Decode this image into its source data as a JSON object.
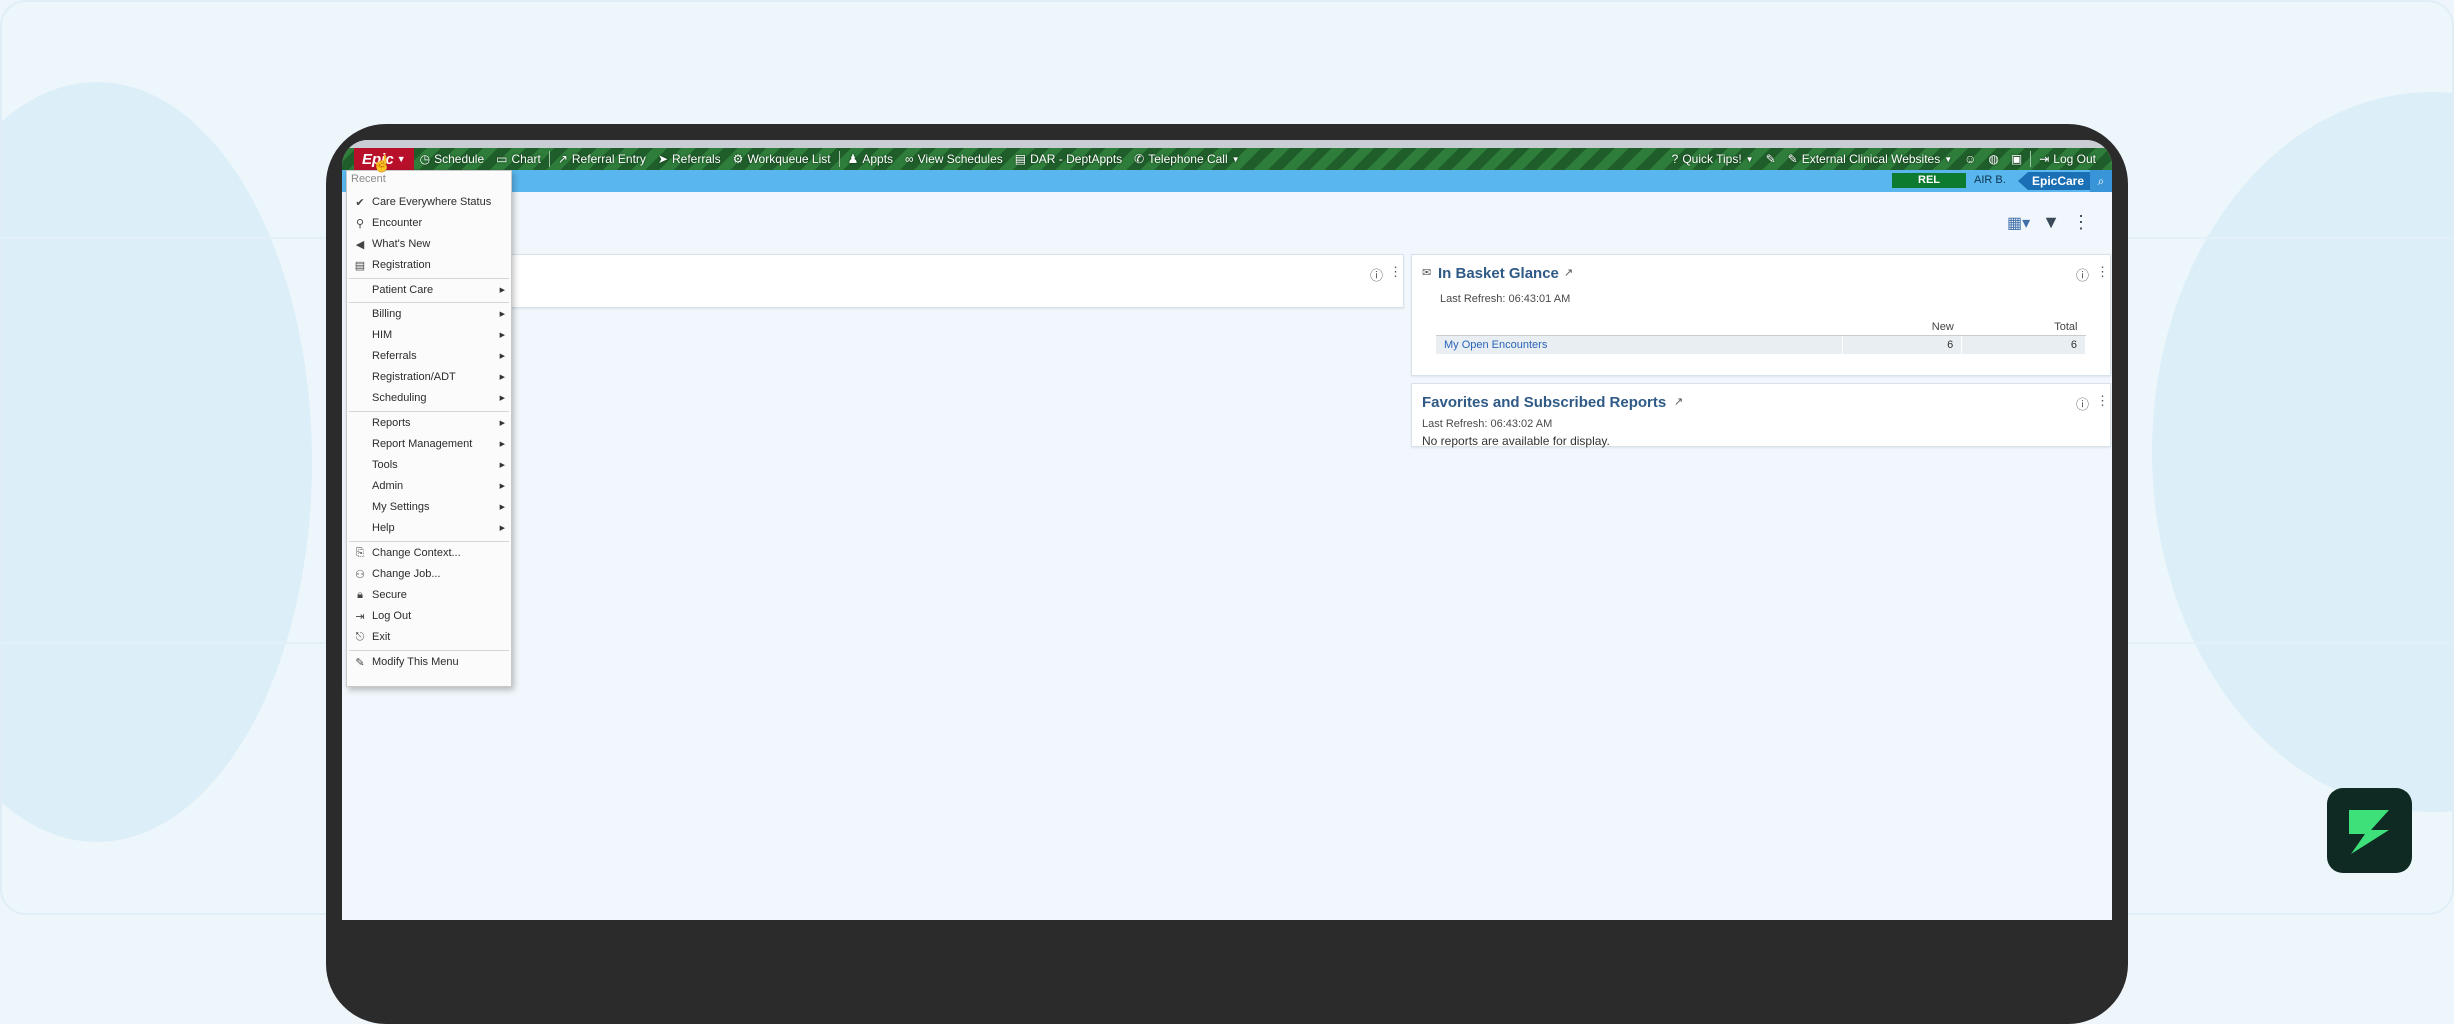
{
  "colors": {
    "accent_green": "#2e7d3a",
    "epic_red": "#b8102a",
    "header_blue": "#5ab6ee",
    "link_blue": "#2a63b8",
    "title_blue": "#2f5a86"
  },
  "toolbar": {
    "epic_label": "Epic",
    "items": [
      {
        "label": "Schedule",
        "icon": "clock-icon"
      },
      {
        "label": "Chart",
        "icon": "folder-icon"
      },
      {
        "label": "Referral Entry",
        "icon": "referral-icon"
      },
      {
        "label": "Referrals",
        "icon": "arrow-icon"
      },
      {
        "label": "Workqueue List",
        "icon": "workqueue-icon"
      },
      {
        "label": "Appts",
        "icon": "people-icon"
      },
      {
        "label": "View Schedules",
        "icon": "binoculars-icon"
      },
      {
        "label": "DAR - DeptAppts",
        "icon": "clipboard-icon"
      },
      {
        "label": "Telephone Call",
        "icon": "phone-icon"
      }
    ],
    "right_items": [
      {
        "label": "Quick Tips!",
        "icon": "help-icon"
      },
      {
        "label": "External Clinical Websites",
        "icon": "wrench-icon"
      },
      {
        "label": "Log Out",
        "icon": "logout-icon"
      }
    ]
  },
  "header": {
    "env_badge": "REL",
    "user": "AIR B.",
    "product": "EpicCare"
  },
  "menu": {
    "header": "Recent",
    "recent": [
      {
        "label": "Care Everywhere Status",
        "icon": "check-icon"
      },
      {
        "label": "Encounter",
        "icon": "encounter-icon"
      },
      {
        "label": "What's New",
        "icon": "megaphone-icon"
      },
      {
        "label": "Registration",
        "icon": "registration-icon"
      }
    ],
    "submenus_a": [
      "Patient Care"
    ],
    "submenus_b": [
      "Billing",
      "HIM",
      "Referrals",
      "Registration/ADT",
      "Scheduling"
    ],
    "submenus_c": [
      "Reports",
      "Report Management",
      "Tools",
      "Admin",
      "My Settings",
      "Help"
    ],
    "actions": [
      {
        "label": "Change Context...",
        "icon": "context-icon"
      },
      {
        "label": "Change Job...",
        "icon": "change-job-icon"
      },
      {
        "label": "Secure",
        "icon": "lock-icon"
      },
      {
        "label": "Log Out",
        "icon": "logout-icon"
      },
      {
        "label": "Exit",
        "icon": "exit-icon"
      }
    ],
    "footer": {
      "label": "Modify This Menu",
      "icon": "wrench-icon"
    }
  },
  "in_basket": {
    "title": "In Basket Glance",
    "last_refresh": "Last Refresh: 06:43:01 AM",
    "columns": [
      "",
      "New",
      "Total"
    ],
    "rows": [
      {
        "name": "My Open Encounters",
        "new": "6",
        "total": "6"
      }
    ]
  },
  "favorites": {
    "title": "Favorites and Subscribed Reports",
    "last_refresh": "Last Refresh: 06:43:02 AM",
    "message": "No reports are available for display."
  }
}
